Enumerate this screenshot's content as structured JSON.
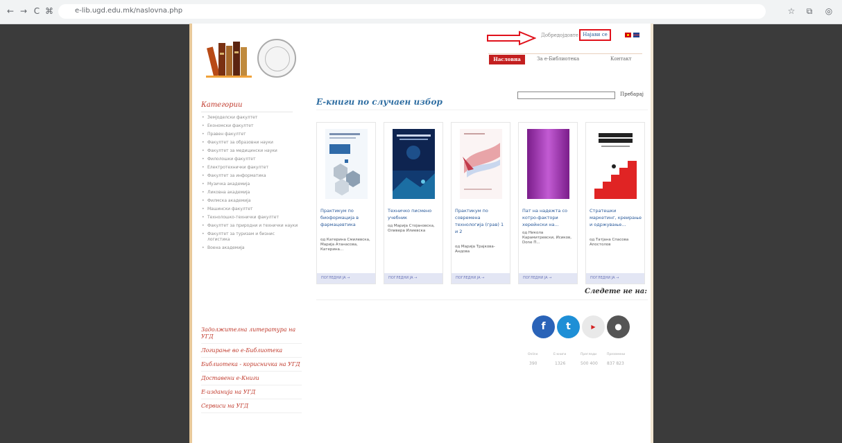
{
  "browser": {
    "url": "e-lib.ugd.edu.mk/naslovna.php",
    "back_icon": "←",
    "forward_icon": "→",
    "reload_icon": "C",
    "star_icon": "☆",
    "extensions_icon": "⧉",
    "profile_icon": "◎"
  },
  "header": {
    "login_text": "Добредојдовте",
    "login_link": "Најави се",
    "nav": {
      "home": "Насловна",
      "about": "За е-Библиотека",
      "contact": "Контакт"
    }
  },
  "search": {
    "button_label": "Пребарај"
  },
  "sidebar": {
    "title": "Категории",
    "categories": [
      "Земјоделски факултет",
      "Економски факултет",
      "Правен факултет",
      "Факултет за образовни науки",
      "Факултет за медицински науки",
      "Филолошки факултет",
      "Електротехнички факултет",
      "Факултет за информатика",
      "Музичка академија",
      "Ликовна академија",
      "Филмска академија",
      "Машински факултет",
      "Технолошко-технички факултет",
      "Факултет за природни и технички науки",
      "Факултет за туризам и бизнис логистика",
      "Воена академија"
    ],
    "links": [
      "Задолжителна литература на УГД",
      "Логирање во е-Библиотека",
      "Библиотека - корисничка на УГД",
      "Доставени е-Книги",
      "Е-изданија на УГД",
      "Сервиси на УГД"
    ]
  },
  "books_section": {
    "title": "Е-книги по случаен избор",
    "books": [
      {
        "title": "Практикум по биоформација в фармацевтика",
        "authors": "од Катерина Смилевска, Марија Атанасова, Катерина...",
        "more": "ПОГЛЕДНИ ЈА →"
      },
      {
        "title": "Техничко писмено учебник",
        "authors": "од Марија Стојановска, Оливера Илиевска",
        "more": "ПОГЛЕДНИ ЈА →"
      },
      {
        "title": "Практикум по современа технологија (грав) 1 и 2",
        "authors": "од Марија Трајкова-Андова",
        "more": "ПОГЛЕДНИ ЈА →"
      },
      {
        "title": "Пат на надежта со котро-фактори херейнски на...",
        "authors": "од Никола Карамитревски, Исиков, Done П...",
        "more": "ПОГЛЕДНИ ЈА →"
      },
      {
        "title": "Стратешки маркетинг, креирање и одржување...",
        "authors": "од Татјана Спасова Апостолов",
        "more": "ПОГЛЕДНИ ЈА →"
      }
    ]
  },
  "follow": {
    "title": "Следете не на:",
    "icons": [
      "facebook-icon",
      "twitter-icon",
      "youtube-icon",
      "apple-icon"
    ]
  },
  "stats": [
    {
      "label": "Online",
      "value": "390"
    },
    {
      "label": "Е-книги",
      "value": "1326"
    },
    {
      "label": "Прегледи",
      "value": "500 400"
    },
    {
      "label": "Преземени",
      "value": "837 823"
    }
  ],
  "colors": {
    "brand_red": "#c31f1f",
    "link_blue": "#2f6ea2",
    "annotation_red": "#e0111b"
  }
}
